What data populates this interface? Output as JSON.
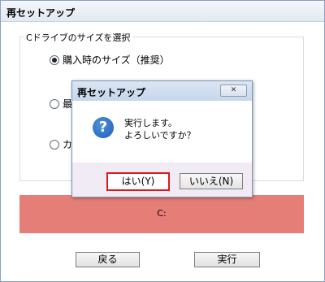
{
  "window": {
    "title": "再セットアップ"
  },
  "size_group": {
    "legend": "Cドライブのサイズを選択",
    "options": [
      {
        "label": "購入時のサイズ（推奨）",
        "checked": true
      },
      {
        "label": "最",
        "checked": false
      },
      {
        "label": "カス",
        "checked": false
      }
    ]
  },
  "drive_bar": {
    "label": "C:",
    "color": "#e57e77"
  },
  "buttons": {
    "back": "戻る",
    "execute": "実行"
  },
  "dialog": {
    "title": "再セットアップ",
    "close_icon": "close-icon",
    "question_icon": "question-icon",
    "message_line1": "実行します。",
    "message_line2": "よろしいですか？",
    "yes": "はい(Y)",
    "no": "いいえ(N)",
    "highlight_color": "#e0161a"
  }
}
